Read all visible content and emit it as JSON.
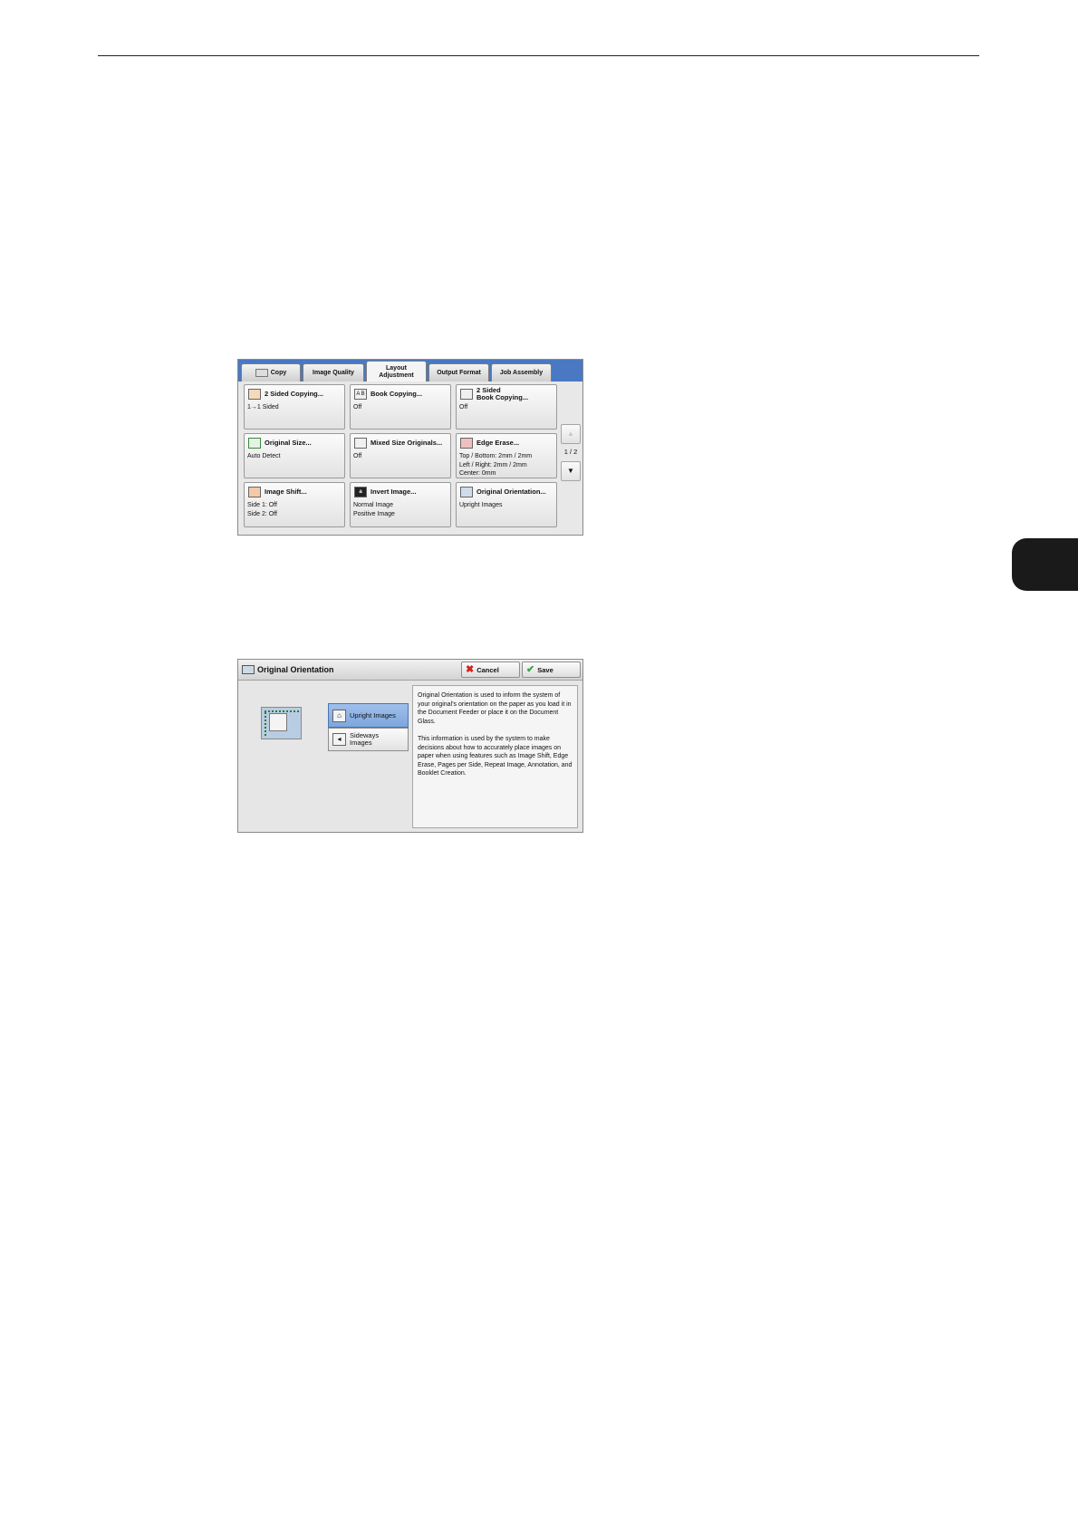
{
  "layout_screen": {
    "tabs": [
      {
        "label": "Copy"
      },
      {
        "label": "Image Quality"
      },
      {
        "label": "Layout\nAdjustment"
      },
      {
        "label": "Output Format"
      },
      {
        "label": "Job Assembly"
      }
    ],
    "features": [
      {
        "title": "2 Sided Copying...",
        "value": "1→1 Sided",
        "icon": "two-sided-icon"
      },
      {
        "title": "Book Copying...",
        "value": "Off",
        "icon": "book-icon"
      },
      {
        "title": "2 Sided\nBook Copying...",
        "value": "Off",
        "icon": "open-book-icon"
      },
      {
        "title": "Original Size...",
        "value": "Auto Detect",
        "icon": "size-icon"
      },
      {
        "title": "Mixed Size Originals...",
        "value": "Off",
        "icon": "mixed-size-icon"
      },
      {
        "title": "Edge Erase...",
        "value": "Top / Bottom: 2mm / 2mm\nLeft / Right: 2mm / 2mm\nCenter: 0mm",
        "icon": "edge-erase-icon"
      },
      {
        "title": "Image Shift...",
        "value": "Side 1: Off\nSide 2: Off",
        "icon": "image-shift-icon"
      },
      {
        "title": "Invert Image...",
        "value": "Normal Image\nPositive Image",
        "icon": "invert-icon"
      },
      {
        "title": "Original Orientation...",
        "value": "Upright Images",
        "icon": "orientation-icon"
      }
    ],
    "page_indicator": "1 / 2",
    "scroll_up": "▲",
    "scroll_down": "▼"
  },
  "orientation_screen": {
    "title": "Original Orientation",
    "cancel_label": "Cancel",
    "save_label": "Save",
    "options": [
      {
        "label": "Upright Images",
        "selected": true
      },
      {
        "label": "Sideways\nImages",
        "selected": false
      }
    ],
    "description": [
      "Original Orientation is used to inform the system of your original’s orientation on the paper as you load it in the Document Feeder or place it on the Document Glass.",
      "This information is used by the system to make decisions about how to accurately place images on paper when using features such as Image Shift, Edge Erase, Pages per Side, Repeat Image, Annotation, and Booklet Creation."
    ]
  },
  "colors": {
    "tab_bar_blue": "#4a78c2",
    "selected_option": "#8fb4e4",
    "chapter_tab": "#1a1a1a"
  }
}
